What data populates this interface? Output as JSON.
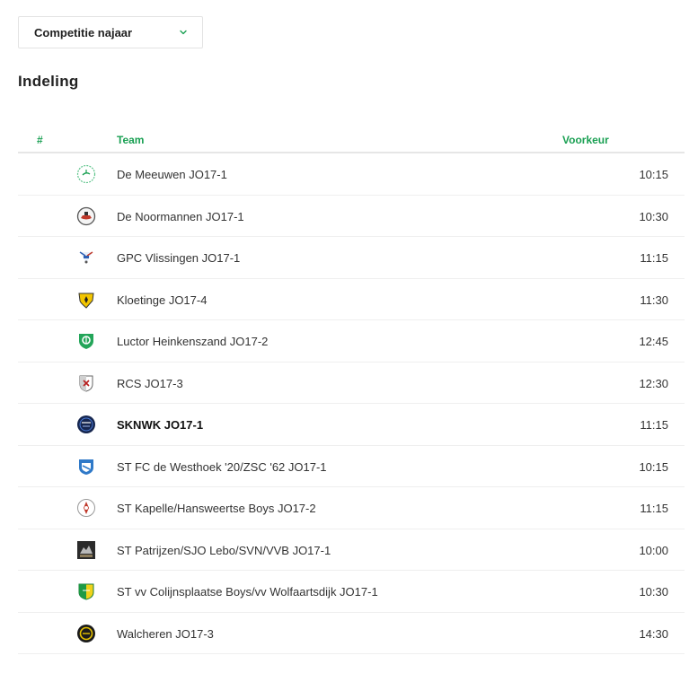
{
  "dropdown": {
    "label": "Competitie najaar",
    "icon": "chevron-down-icon"
  },
  "section": {
    "title": "Indeling"
  },
  "table": {
    "headers": {
      "num": "#",
      "team": "Team",
      "preference": "Voorkeur"
    },
    "rows": [
      {
        "team": "De Meeuwen JO17-1",
        "time": "10:15",
        "logo": "de-meeuwen-logo",
        "highlight": false
      },
      {
        "team": "De Noormannen JO17-1",
        "time": "10:30",
        "logo": "de-noormannen-logo",
        "highlight": false
      },
      {
        "team": "GPC Vlissingen JO17-1",
        "time": "11:15",
        "logo": "gpc-vlissingen-logo",
        "highlight": false
      },
      {
        "team": "Kloetinge JO17-4",
        "time": "11:30",
        "logo": "kloetinge-logo",
        "highlight": false
      },
      {
        "team": "Luctor Heinkenszand JO17-2",
        "time": "12:45",
        "logo": "luctor-heinkenszand-logo",
        "highlight": false
      },
      {
        "team": "RCS JO17-3",
        "time": "12:30",
        "logo": "rcs-logo",
        "highlight": false
      },
      {
        "team": "SKNWK JO17-1",
        "time": "11:15",
        "logo": "sknwk-logo",
        "highlight": true
      },
      {
        "team": "ST FC de Westhoek '20/ZSC '62 JO17-1",
        "time": "10:15",
        "logo": "westhoek-logo",
        "highlight": false
      },
      {
        "team": "ST Kapelle/Hansweertse Boys JO17-2",
        "time": "11:15",
        "logo": "kapelle-logo",
        "highlight": false
      },
      {
        "team": "ST Patrijzen/SJO Lebo/SVN/VVB JO17-1",
        "time": "10:00",
        "logo": "patrijzen-logo",
        "highlight": false
      },
      {
        "team": "ST vv Colijnsplaatse Boys/vv Wolfaartsdijk JO17-1",
        "time": "10:30",
        "logo": "colijnsplaatse-logo",
        "highlight": false
      },
      {
        "team": "Walcheren JO17-3",
        "time": "14:30",
        "logo": "walcheren-logo",
        "highlight": false
      }
    ]
  },
  "colors": {
    "accent": "#1aa053",
    "text": "#333333",
    "divider": "#efefef"
  }
}
